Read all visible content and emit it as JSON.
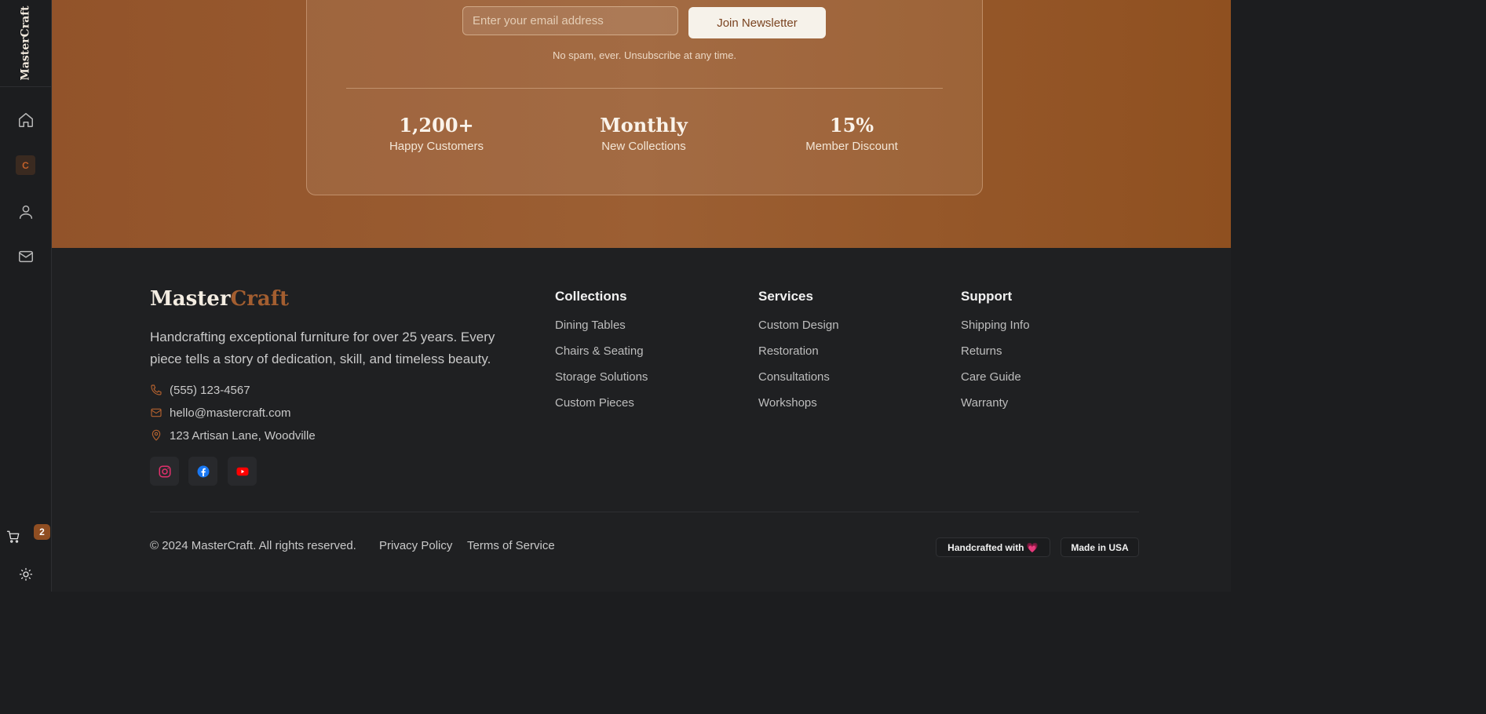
{
  "sidebar": {
    "brand": "MasterCraft",
    "items": [
      {
        "name": "home",
        "icon": "home-icon"
      },
      {
        "name": "collections",
        "icon": "collections-icon",
        "letter": "C"
      },
      {
        "name": "account",
        "icon": "user-icon"
      },
      {
        "name": "contact",
        "icon": "mail-icon"
      }
    ],
    "cart": {
      "icon": "cart-icon",
      "count": "2"
    },
    "theme_toggle": {
      "icon": "sun-icon"
    }
  },
  "newsletter": {
    "email_placeholder": "Enter your email address",
    "button_label": "Join Newsletter",
    "note": "No spam, ever. Unsubscribe at any time.",
    "stats": [
      {
        "value": "1,200+",
        "label": "Happy Customers"
      },
      {
        "value": "Monthly",
        "label": "New Collections"
      },
      {
        "value": "15%",
        "label": "Member Discount"
      }
    ]
  },
  "footer": {
    "logo_part1": "Master",
    "logo_part2": "Craft",
    "tagline": "Handcrafting exceptional furniture for over 25 years. Every piece tells a story of dedication, skill, and timeless beauty.",
    "contacts": [
      {
        "icon": "phone-icon",
        "text": "(555) 123-4567"
      },
      {
        "icon": "mail-icon",
        "text": "hello@mastercraft.com"
      },
      {
        "icon": "map-pin-icon",
        "text": "123 Artisan Lane, Woodville"
      }
    ],
    "social": [
      {
        "icon": "instagram-icon",
        "color": "#e1306c"
      },
      {
        "icon": "facebook-icon",
        "color": "#1877f2"
      },
      {
        "icon": "youtube-icon",
        "color": "#ff0000"
      }
    ],
    "columns": [
      {
        "title": "Collections",
        "links": [
          "Dining Tables",
          "Chairs & Seating",
          "Storage Solutions",
          "Custom Pieces"
        ]
      },
      {
        "title": "Services",
        "links": [
          "Custom Design",
          "Restoration",
          "Consultations",
          "Workshops"
        ]
      },
      {
        "title": "Support",
        "links": [
          "Shipping Info",
          "Returns",
          "Care Guide",
          "Warranty"
        ]
      }
    ],
    "copyright": "© 2024 MasterCraft. All rights reserved.",
    "privacy": "Privacy Policy",
    "terms": "Terms of Service",
    "badge_handcrafted": "Handcrafted with",
    "badge_heart": "💗",
    "badge_made": "Made in USA"
  },
  "colors": {
    "accent": "#a35e30",
    "band": "#92532a",
    "footer_bg": "#1f2022"
  }
}
